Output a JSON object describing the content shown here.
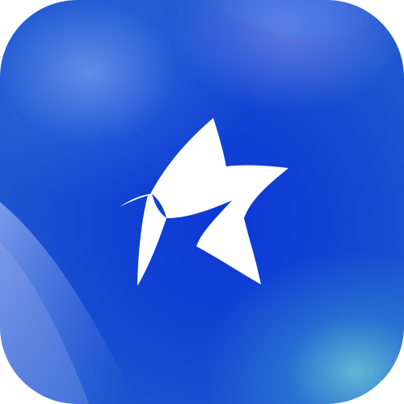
{
  "icon": {
    "name": "star-logo",
    "colors": {
      "background_center": "#0c37d6",
      "background_edge": "#1c56cf",
      "highlight_top_left": "#78a0f0",
      "highlight_bottom_right": "#6ec8d7",
      "mark": "#ffffff"
    }
  }
}
